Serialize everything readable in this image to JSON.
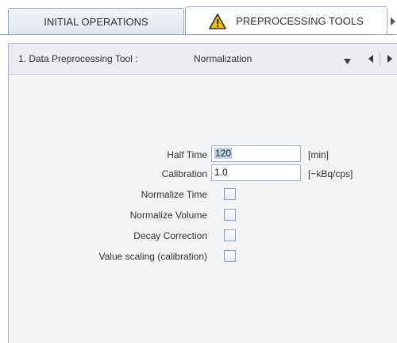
{
  "tabs": [
    {
      "label": "INITIAL OPERATIONS",
      "active": false
    },
    {
      "label": "PREPROCESSING TOOLS",
      "active": true,
      "icon": "warning-icon"
    }
  ],
  "toolbar": {
    "tool_label": "1. Data Preprocessing Tool :",
    "selected_tool": "Normalization"
  },
  "form": {
    "half_time": {
      "label": "Half Time",
      "value": "120",
      "unit": "[min]"
    },
    "calibration": {
      "label": "Calibration",
      "value": "1.0",
      "unit": "[~kBq/cps]"
    },
    "normalize_time": {
      "label": "Normalize Time",
      "checked": false
    },
    "normalize_volume": {
      "label": "Normalize Volume",
      "checked": false
    },
    "decay_correction": {
      "label": "Decay Correction",
      "checked": false
    },
    "value_scaling": {
      "label": "Value scaling (calibration)",
      "checked": false
    }
  },
  "colors": {
    "accent_selection": "#bcd0ea",
    "warning": "#f5c400"
  }
}
